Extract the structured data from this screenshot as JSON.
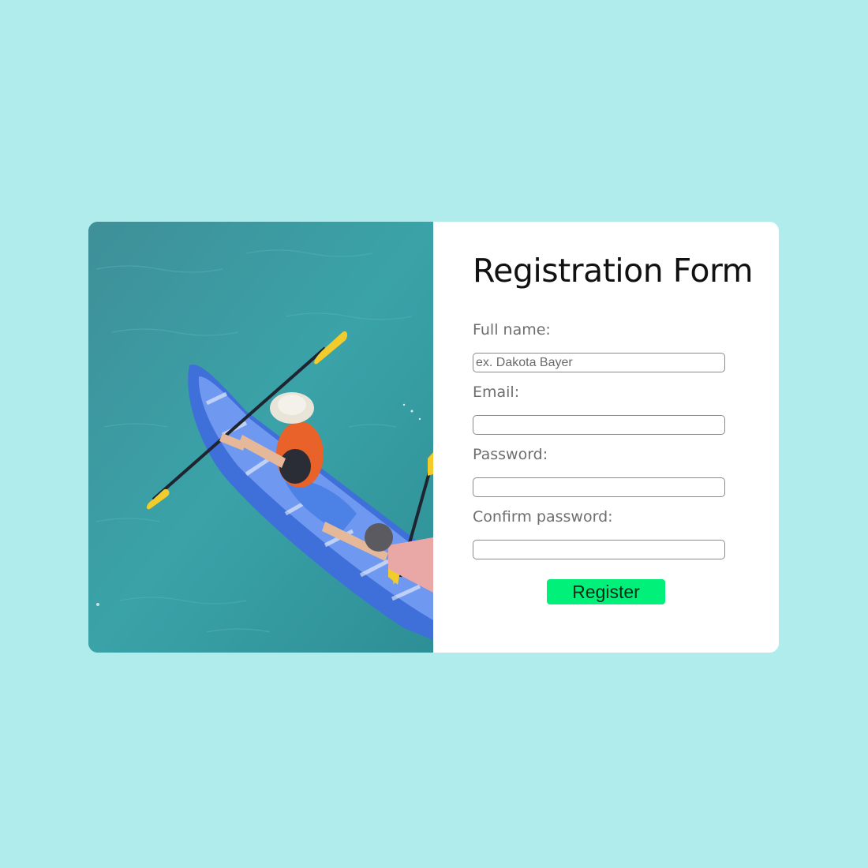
{
  "form": {
    "title": "Registration Form",
    "fields": [
      {
        "label": "Full name:",
        "placeholder": "ex. Dakota Bayer",
        "value": ""
      },
      {
        "label": "Email:",
        "placeholder": "",
        "value": ""
      },
      {
        "label": "Password:",
        "placeholder": "",
        "value": ""
      },
      {
        "label": "Confirm password:",
        "placeholder": "",
        "value": ""
      }
    ],
    "submit_label": "Register"
  },
  "image": {
    "subject": "kayak-photo"
  },
  "colors": {
    "background": "#b0ecec",
    "card": "#ffffff",
    "button": "#00f07a",
    "water": "#3a9aa0"
  }
}
